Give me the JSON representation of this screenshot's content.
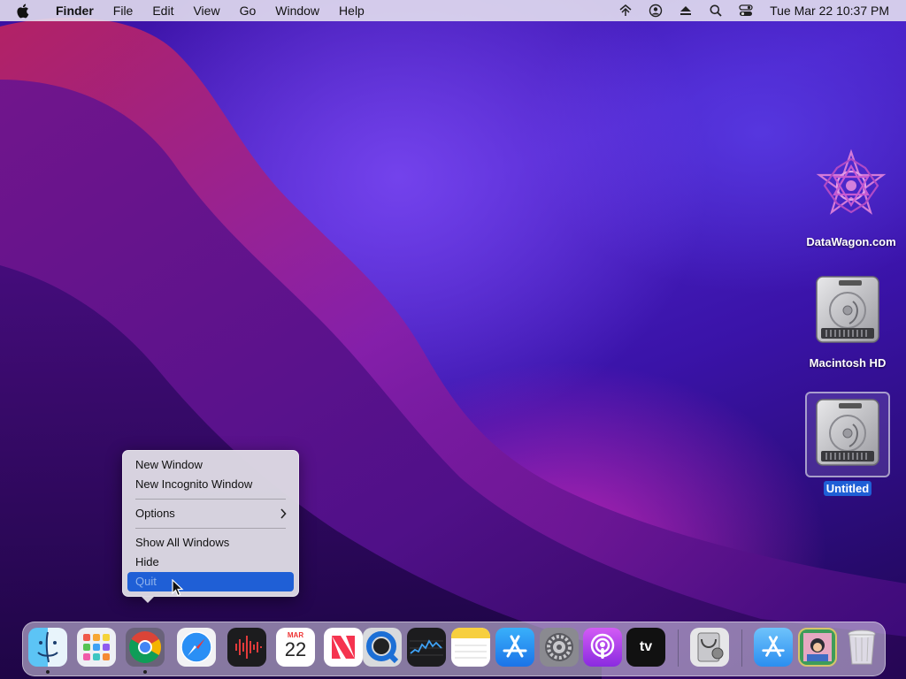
{
  "menubar": {
    "app_name": "Finder",
    "items": [
      "File",
      "Edit",
      "View",
      "Go",
      "Window",
      "Help"
    ],
    "clock": "Tue Mar 22  10:37 PM",
    "status_icons": [
      "wifi-signal-icon",
      "user-account-icon",
      "eject-icon",
      "spotlight-search-icon",
      "control-center-icon"
    ]
  },
  "desktop": {
    "icons": [
      {
        "label": "DataWagon.com",
        "icon": "datawagon-logo-icon",
        "selected": false
      },
      {
        "label": "Macintosh HD",
        "icon": "hard-drive-icon",
        "selected": false
      },
      {
        "label": "Untitled",
        "icon": "hard-drive-icon",
        "selected": true
      }
    ]
  },
  "context_menu": {
    "app": "Google Chrome",
    "items": {
      "new_window": "New Window",
      "new_incognito": "New Incognito Window",
      "options": "Options",
      "show_all": "Show All Windows",
      "hide": "Hide",
      "quit": "Quit"
    },
    "highlighted": "Quit"
  },
  "dock": {
    "apps": [
      {
        "name": "Finder",
        "icon": "finder-icon",
        "running": true
      },
      {
        "name": "Launchpad",
        "icon": "launchpad-icon",
        "running": false
      },
      {
        "name": "Google Chrome",
        "icon": "chrome-icon",
        "running": true
      },
      {
        "name": "Safari",
        "icon": "safari-icon",
        "running": false
      },
      {
        "name": "Voice Memos",
        "icon": "voice-memos-icon",
        "running": false
      },
      {
        "name": "Calendar",
        "icon": "calendar-icon",
        "running": false,
        "month": "MAR",
        "day": "22"
      },
      {
        "name": "News",
        "icon": "news-icon",
        "running": false
      },
      {
        "name": "QuickTime Player",
        "icon": "quicktime-icon",
        "running": false
      },
      {
        "name": "Stocks",
        "icon": "stocks-icon",
        "running": false
      },
      {
        "name": "Notes",
        "icon": "notes-icon",
        "running": false
      },
      {
        "name": "App Store",
        "icon": "app-store-icon",
        "running": false
      },
      {
        "name": "System Preferences",
        "icon": "system-preferences-icon",
        "running": false
      },
      {
        "name": "Podcasts",
        "icon": "podcasts-icon",
        "running": false
      },
      {
        "name": "TV",
        "icon": "apple-tv-icon",
        "running": false,
        "label": "tv"
      },
      {
        "name": "Disk Utility",
        "icon": "disk-utility-icon",
        "running": false
      },
      {
        "name": "Applications",
        "icon": "applications-folder-icon",
        "running": false
      },
      {
        "name": "Downloads",
        "icon": "downloads-stack-icon",
        "running": false
      },
      {
        "name": "Trash",
        "icon": "trash-icon",
        "running": false
      }
    ]
  },
  "colors": {
    "selection_blue": "#1f5fd6",
    "wallpaper_purple": "#3a10a0",
    "wallpaper_magenta": "#cd28be"
  }
}
